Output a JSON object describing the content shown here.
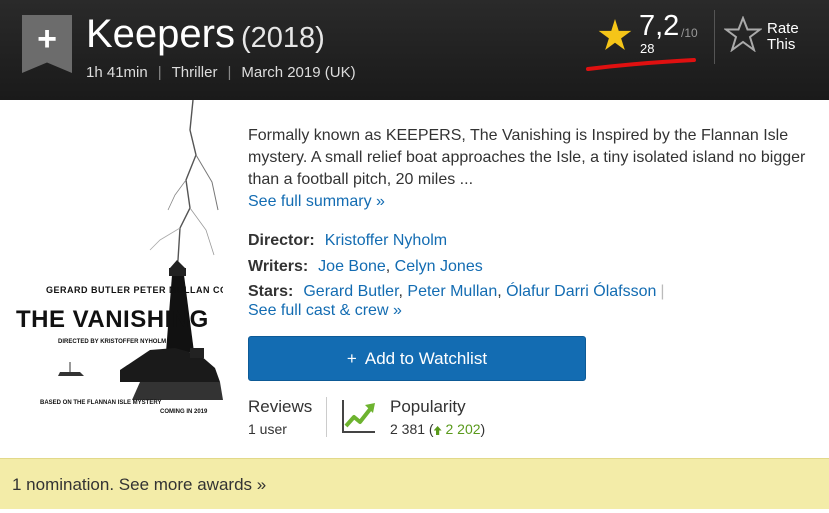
{
  "header": {
    "title": "Keepers",
    "year": "(2018)",
    "runtime": "1h 41min",
    "genre": "Thriller",
    "release": "March 2019 (UK)",
    "watchlist_ribbon_icon": "plus-icon"
  },
  "rating": {
    "value": "7,2",
    "out_of": "/10",
    "count": "28",
    "star_color": "#f5c518"
  },
  "rate_this": {
    "label": "Rate This"
  },
  "poster": {
    "actors": "GERARD BUTLER   PETER MULLAN   CONNOR SWINDELLS",
    "title": "THE VANISHING",
    "director": "DIRECTED BY KRISTOFFER NYHOLM",
    "based_on": "BASED ON THE FLANNAN ISLE MYSTERY",
    "coming": "COMING IN 2019"
  },
  "summary": {
    "text": "Formally known as KEEPERS, The Vanishing is Inspired by the Flannan Isle mystery. A small relief boat approaches the Isle, a tiny isolated island no bigger than a football pitch, 20 miles ...",
    "see_full": "See full summary »"
  },
  "credits": {
    "director_label": "Director:",
    "director": "Kristoffer Nyholm",
    "writers_label": "Writers:",
    "writer1": "Joe Bone",
    "writer2": "Celyn Jones",
    "stars_label": "Stars:",
    "star1": "Gerard Butler",
    "star2": "Peter Mullan",
    "star3": "Ólafur Darri Ólafsson",
    "full_cast": "See full cast & crew »"
  },
  "watchlist": {
    "label": "Add to Watchlist"
  },
  "reviews": {
    "label": "Reviews",
    "count": "1 user"
  },
  "popularity": {
    "label": "Popularity",
    "rank": "2 381",
    "change": "2 202",
    "trend_color": "#5a9a1c"
  },
  "awards": {
    "text": "1 nomination. See more awards »"
  },
  "colors": {
    "link": "#136cb2",
    "header_bg": "#1f1f1f",
    "awards_bg": "#f3eca8",
    "button": "#136cb2"
  }
}
